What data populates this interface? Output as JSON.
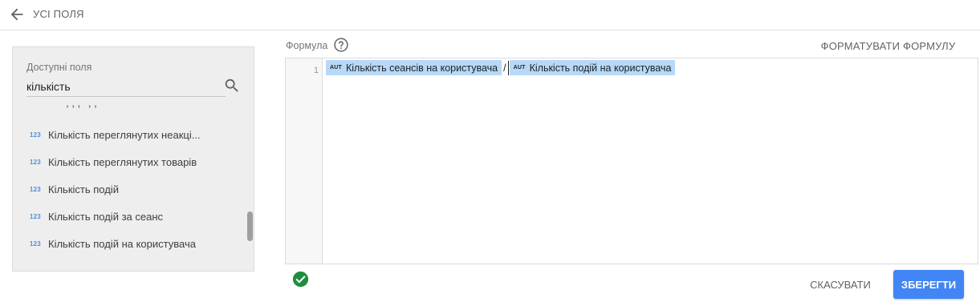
{
  "header": {
    "back_icon": "arrow-back-icon",
    "title": "УСІ ПОЛЯ"
  },
  "fields_panel": {
    "label": "Доступні поля",
    "search_value": "кількість",
    "search_icon": "search-icon",
    "items": [
      {
        "type": "123",
        "label": "Кількість переглянутих неакці..."
      },
      {
        "type": "123",
        "label": "Кількість переглянутих товарів"
      },
      {
        "type": "123",
        "label": "Кількість подій"
      },
      {
        "type": "123",
        "label": "Кількість подій за сеанс"
      },
      {
        "type": "123",
        "label": "Кількість подій на користувача"
      }
    ]
  },
  "formula": {
    "label": "Формула",
    "help_icon": "help-circle-icon",
    "format_button": "ФОРМАТУВАТИ ФОРМУЛУ",
    "line_number": "1",
    "chip1": {
      "type": "AUT",
      "label": "Кількість сеансів на користувача"
    },
    "operator": "/",
    "chip2": {
      "type": "AUT",
      "label": "Кількість подій на користувача"
    }
  },
  "footer": {
    "status_icon": "check-circle-icon",
    "cancel_button": "СКАСУВАТИ",
    "save_button": "ЗБЕРЕГТИ"
  },
  "colors": {
    "accent": "#4285f4",
    "chip_bg": "#b7d9f7",
    "success": "#1e8e3e",
    "panel_bg": "#eeeeee"
  }
}
